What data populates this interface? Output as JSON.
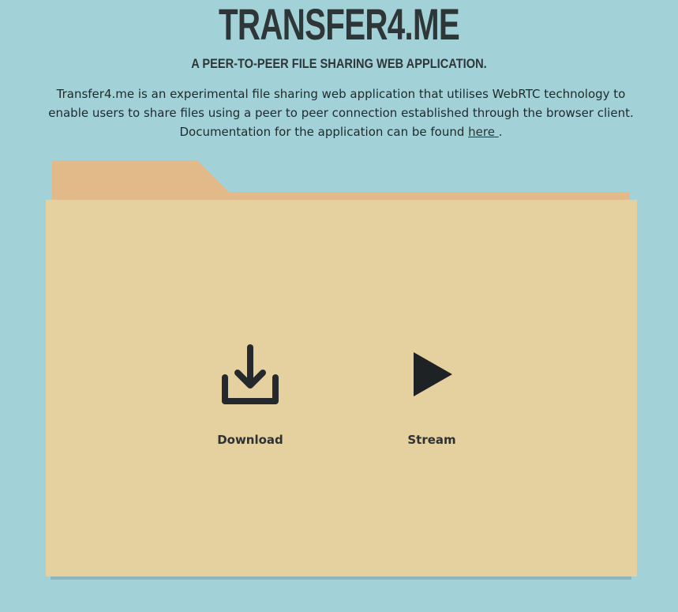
{
  "header": {
    "title": "TRANSFER4.ME",
    "tagline": "A PEER-TO-PEER FILE SHARING WEB APPLICATION."
  },
  "intro": {
    "line1": "Transfer4.me is an experimental file sharing web application that utilises WebRTC technology to enable users to share files using a peer to peer connection established through the browser client.",
    "line2_prefix": "Documentation for the application can be found ",
    "link_label": "here ",
    "line2_suffix": "."
  },
  "actions": {
    "download": {
      "label": "Download",
      "icon": "download-icon"
    },
    "stream": {
      "label": "Stream",
      "icon": "play-icon"
    }
  },
  "colors": {
    "background": "#a2d2d8",
    "folder_body": "#e5d09f",
    "folder_tab": "#e2ba89",
    "text": "#2d3234"
  }
}
